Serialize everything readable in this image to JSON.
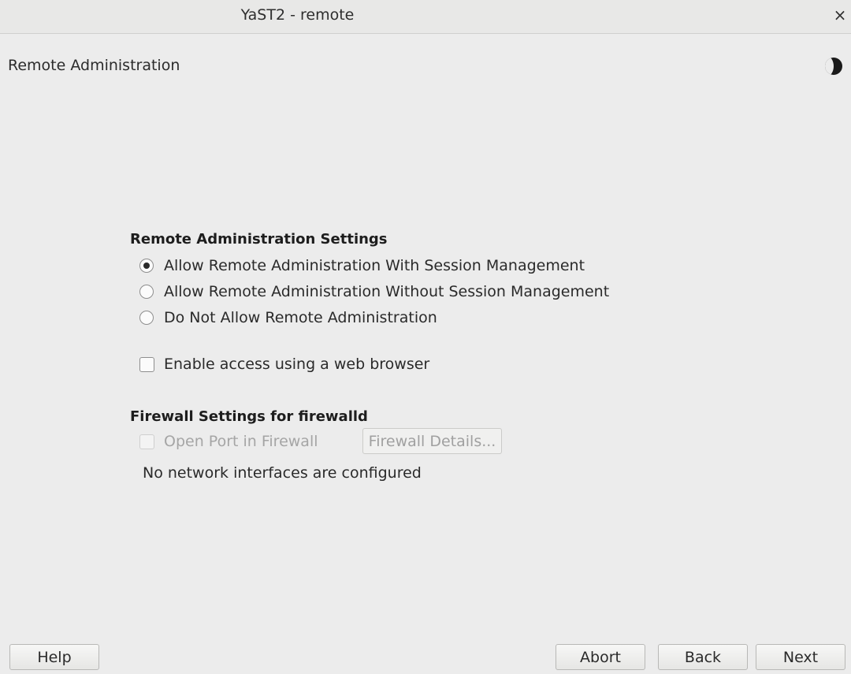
{
  "window": {
    "title": "YaST2 - remote",
    "close_symbol": "×"
  },
  "page": {
    "heading": "Remote Administration",
    "icon": "moon-icon"
  },
  "remote_settings": {
    "title": "Remote Administration Settings",
    "options": [
      {
        "label": "Allow Remote Administration With Session Management",
        "selected": true
      },
      {
        "label": "Allow Remote Administration Without Session Management",
        "selected": false
      },
      {
        "label": "Do Not Allow Remote Administration",
        "selected": false
      }
    ],
    "web_browser": {
      "label": "Enable access using a web browser",
      "checked": false
    }
  },
  "firewall": {
    "title": "Firewall Settings for firewalld",
    "open_port": {
      "label": "Open Port in Firewall",
      "checked": false,
      "enabled": false
    },
    "details_button": "Firewall Details...",
    "status": "No network interfaces are configured"
  },
  "buttons": {
    "help": "Help",
    "abort": "Abort",
    "back": "Back",
    "next": "Next"
  }
}
